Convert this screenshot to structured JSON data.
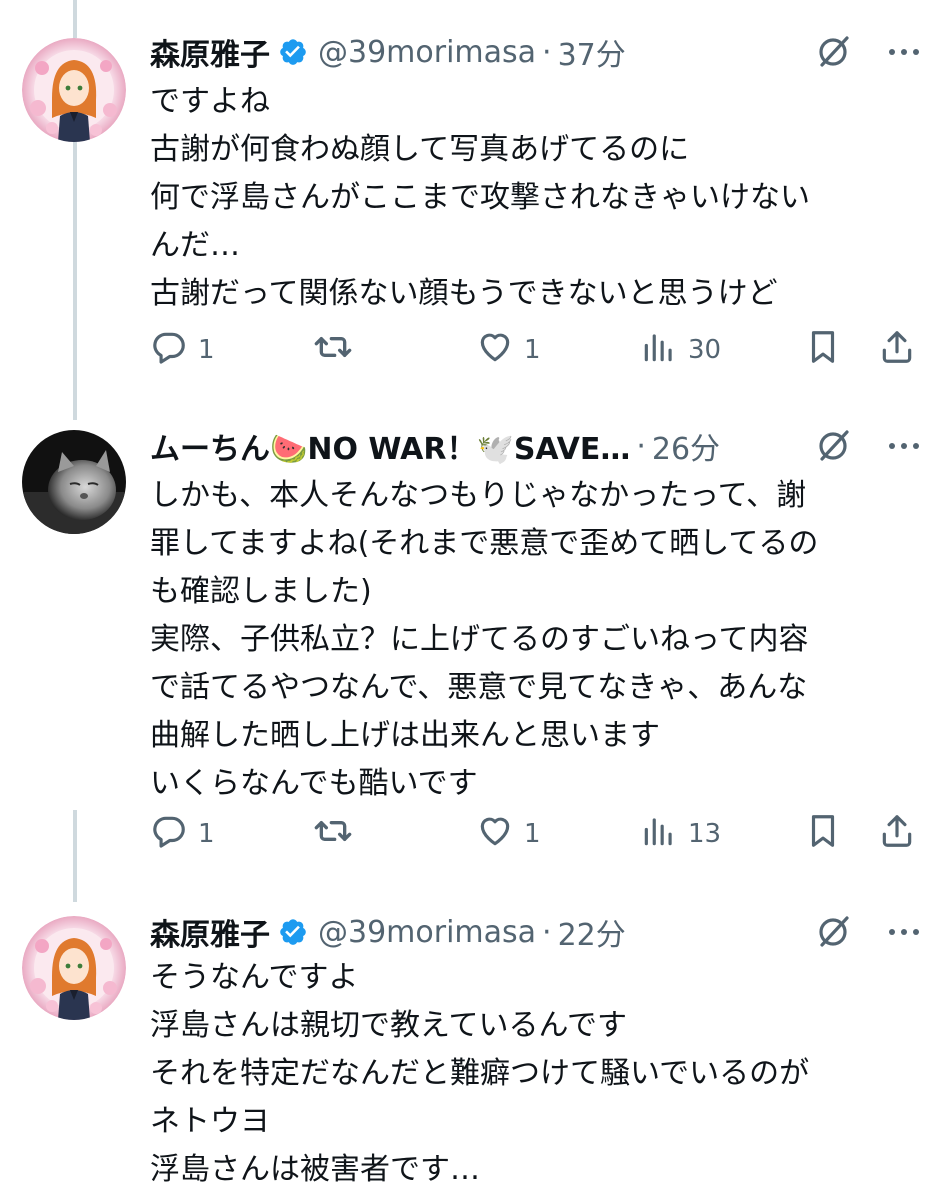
{
  "tweets": [
    {
      "display_name": "森原雅子",
      "verified": true,
      "handle": "@39morimasa",
      "separator": "·",
      "time": "37分",
      "lines": [
        "ですよね",
        "古謝が何食わぬ顔して写真あげてるのに",
        "何で浮島さんがここまで攻撃されなきゃいけない",
        "んだ…",
        "古謝だって関係ない顔もうできないと思うけど"
      ],
      "reply_count": "1",
      "like_count": "1",
      "view_count": "30"
    },
    {
      "display_name": "ムーちん🍉NO WAR！🕊️SAVE…",
      "verified": false,
      "separator": "·",
      "time": "26分",
      "lines": [
        "しかも、本人そんなつもりじゃなかったって、謝",
        "罪してますよね(それまで悪意で歪めて晒してるの",
        "も確認しました)",
        "実際、子供私立？に上げてるのすごいねって内容",
        "で話てるやつなんで、悪意で見てなきゃ、あんな",
        "曲解した晒し上げは出来んと思います",
        "いくらなんでも酷いです"
      ],
      "reply_count": "1",
      "like_count": "1",
      "view_count": "13"
    },
    {
      "display_name": "森原雅子",
      "verified": true,
      "handle": "@39morimasa",
      "separator": "·",
      "time": "22分",
      "lines": [
        "そうなんですよ",
        "浮島さんは親切で教えているんです",
        "それを特定だなんだと難癖つけて騒いでいるのが",
        "ネトウヨ",
        "浮島さんは被害者です…"
      ]
    }
  ],
  "icons": {
    "verified": "verified-badge-icon",
    "grok": "grok-icon",
    "more": "more-icon",
    "reply": "reply-icon",
    "retweet": "retweet-icon",
    "like": "like-icon",
    "views": "views-icon",
    "bookmark": "bookmark-icon",
    "share": "share-icon"
  },
  "colors": {
    "text": "#0f1419",
    "secondary": "#536471",
    "verified": "#1d9bf0",
    "thread_line": "#cfd9de"
  }
}
